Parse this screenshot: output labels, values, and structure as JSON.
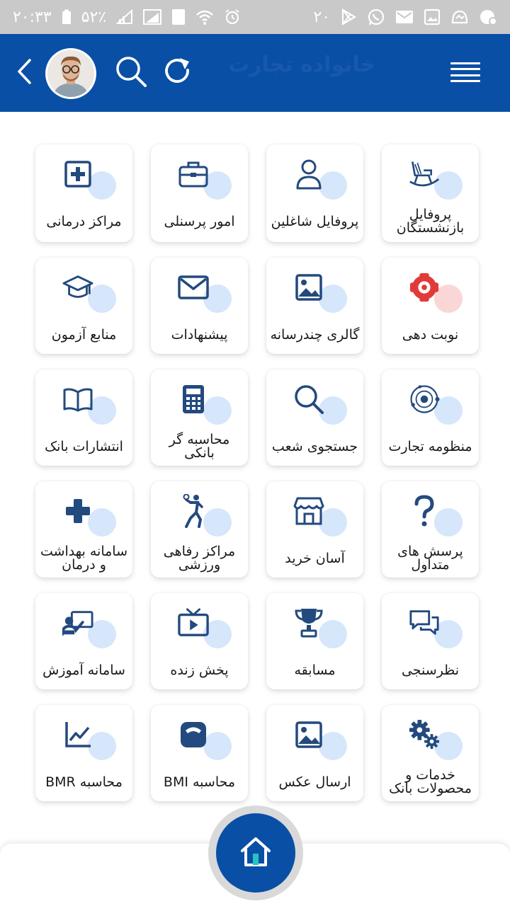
{
  "status_bar": {
    "time": "۲۰:۳۳",
    "battery": "۵۲٪",
    "notification_count": "۲۰",
    "sim_slot": "1"
  },
  "header": {
    "logo_text": "خانواده تجارت"
  },
  "colors": {
    "primary": "#0a4fa6",
    "icon": "#234a7e",
    "accent_blob": "#d6e6fb",
    "status_bar": "#c9c9c9"
  },
  "tiles": [
    {
      "label": "پروفایل بازنشستگان",
      "icon": "rocking-chair-icon"
    },
    {
      "label": "پروفایل شاغلین",
      "icon": "user-icon"
    },
    {
      "label": "امور پرسنلی",
      "icon": "briefcase-icon"
    },
    {
      "label": "مراکز درمانی",
      "icon": "medical-plus-icon"
    },
    {
      "label": "نوبت دهی",
      "icon": "appointment-icon"
    },
    {
      "label": "گالری چندرسانه",
      "icon": "image-icon"
    },
    {
      "label": "پیشنهادات",
      "icon": "envelope-icon"
    },
    {
      "label": "منابع آزمون",
      "icon": "graduation-cap-icon"
    },
    {
      "label": "منظومه تجارت",
      "icon": "orbit-logo-icon"
    },
    {
      "label": "جستجوی شعب",
      "icon": "search-icon"
    },
    {
      "label": "محاسبه گر بانکی",
      "icon": "calculator-icon"
    },
    {
      "label": "انتشارات بانک",
      "icon": "book-icon"
    },
    {
      "label": "پرسش های متداول",
      "icon": "question-icon"
    },
    {
      "label": "آسان خرید",
      "icon": "store-icon"
    },
    {
      "label": "مراکز رفاهی ورزشی",
      "icon": "volleyball-player-icon"
    },
    {
      "label": "سامانه بهداشت و درمان",
      "icon": "health-cross-icon"
    },
    {
      "label": "نظرسنجی",
      "icon": "chat-bubbles-icon"
    },
    {
      "label": "مسابقه",
      "icon": "trophy-icon"
    },
    {
      "label": "پخش زنده",
      "icon": "tv-play-icon"
    },
    {
      "label": "سامانه آموزش",
      "icon": "teacher-board-icon"
    },
    {
      "label": "خدمات و محصولات بانک",
      "icon": "gears-icon"
    },
    {
      "label": "ارسال عکس",
      "icon": "photo-icon"
    },
    {
      "label": "محاسبه BMI",
      "icon": "scale-icon"
    },
    {
      "label": "محاسبه BMR",
      "icon": "line-chart-icon"
    }
  ],
  "bottom_nav": {
    "home_icon": "home-icon"
  }
}
